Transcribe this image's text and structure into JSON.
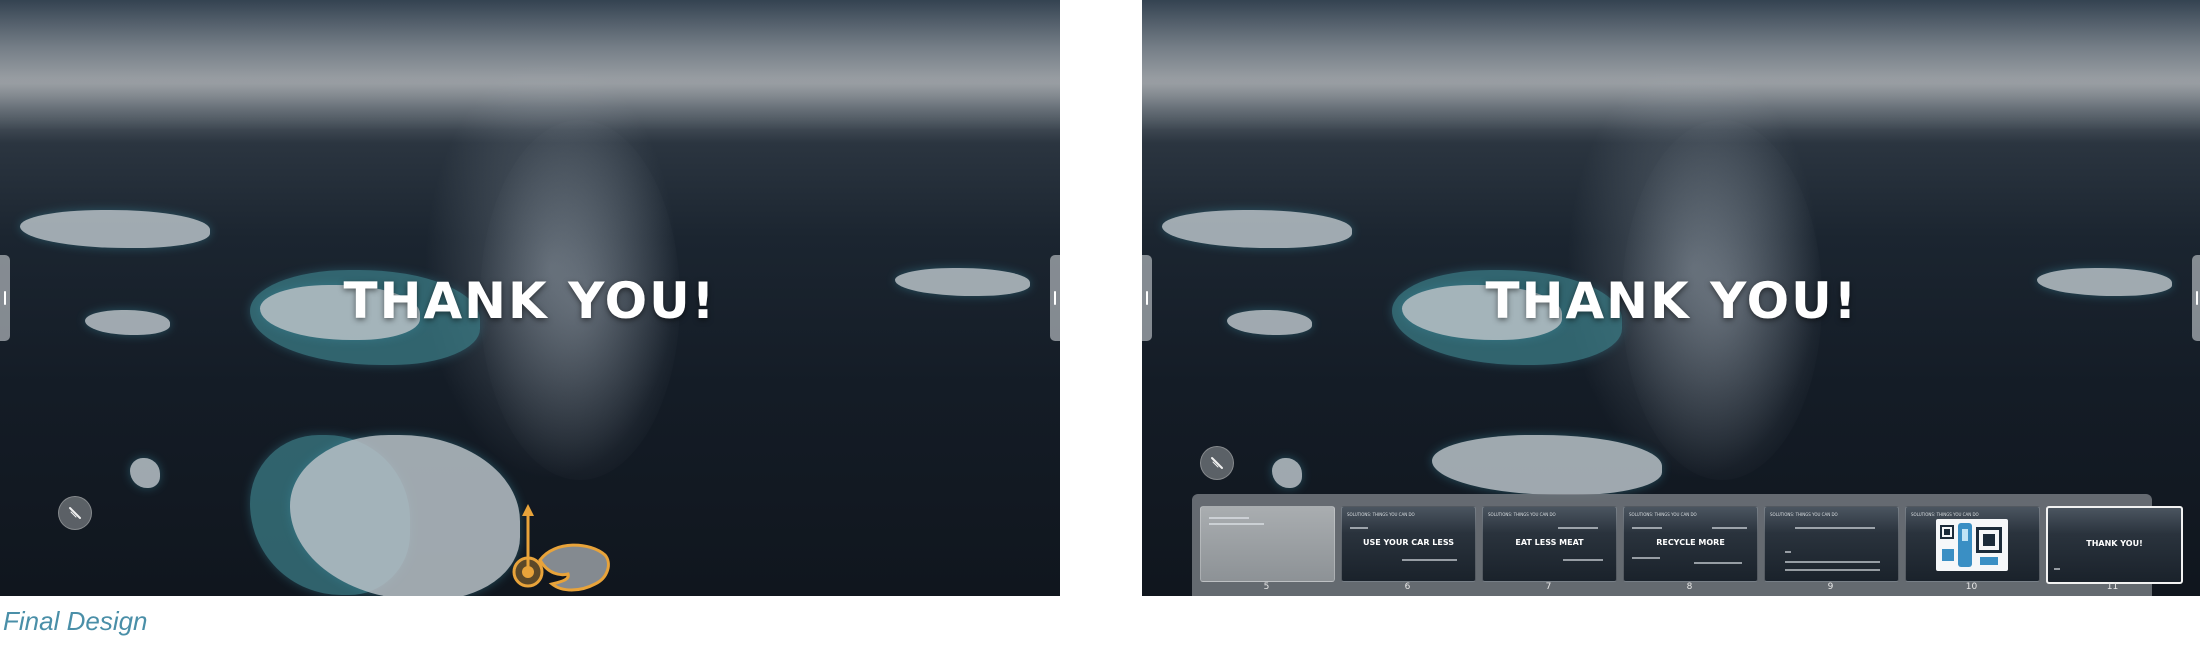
{
  "left_screen": {
    "slide_title": "THANK YOU!",
    "pen_icon": "pencil-icon",
    "gesture_icon": "swipe-up-hand-icon"
  },
  "right_screen": {
    "slide_title": "THANK YOU!",
    "pen_icon": "pencil-icon",
    "thumbnails": [
      {
        "number": "5",
        "title": "",
        "header": ""
      },
      {
        "number": "6",
        "title": "USE YOUR CAR LESS",
        "header": "SOLUTIONS: THINGS YOU CAN DO"
      },
      {
        "number": "7",
        "title": "EAT LESS MEAT",
        "header": "SOLUTIONS: THINGS YOU CAN DO"
      },
      {
        "number": "8",
        "title": "RECYCLE MORE",
        "header": "SOLUTIONS: THINGS YOU CAN DO"
      },
      {
        "number": "9",
        "title": "",
        "header": "SOLUTIONS: THINGS YOU CAN DO"
      },
      {
        "number": "10",
        "title": "",
        "header": "SOLUTIONS: THINGS YOU CAN DO"
      },
      {
        "number": "11",
        "title": "THANK YOU!",
        "header": ""
      }
    ],
    "selected_thumbnail": "11"
  },
  "caption": "Final Design",
  "colors": {
    "accent_orange": "#e8a33a",
    "caption_blue": "#4a8fa8"
  }
}
